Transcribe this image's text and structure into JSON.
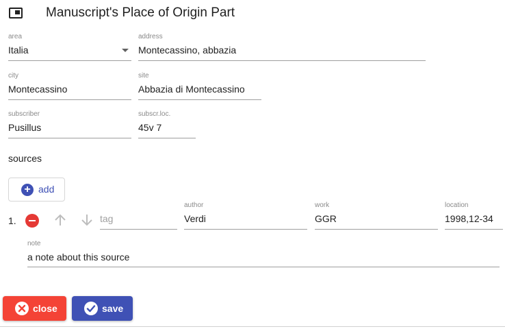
{
  "header": {
    "title": "Manuscript's Place of Origin Part",
    "icon": "picture-in-picture-icon"
  },
  "form": {
    "area": {
      "label": "area",
      "value": "Italia"
    },
    "address": {
      "label": "address",
      "value": "Montecassino, abbazia"
    },
    "city": {
      "label": "city",
      "value": "Montecassino"
    },
    "site": {
      "label": "site",
      "value": "Abbazia di Montecassino"
    },
    "subscriber": {
      "label": "subscriber",
      "value": "Pusillus"
    },
    "subscr_loc": {
      "label": "subscr.loc.",
      "value": "45v 7"
    }
  },
  "sources": {
    "title": "sources",
    "add_label": "add",
    "rows": [
      {
        "number": "1.",
        "tag_placeholder": "tag",
        "author_label": "author",
        "author": "Verdi",
        "work_label": "work",
        "work": "GGR",
        "location_label": "location",
        "location": "1998,12-34",
        "note_label": "note",
        "note": "a note about this source"
      }
    ]
  },
  "actions": {
    "close_label": "close",
    "save_label": "save"
  },
  "colors": {
    "primary": "#3f51b5",
    "warn": "#f44336",
    "remove": "#e53935"
  }
}
